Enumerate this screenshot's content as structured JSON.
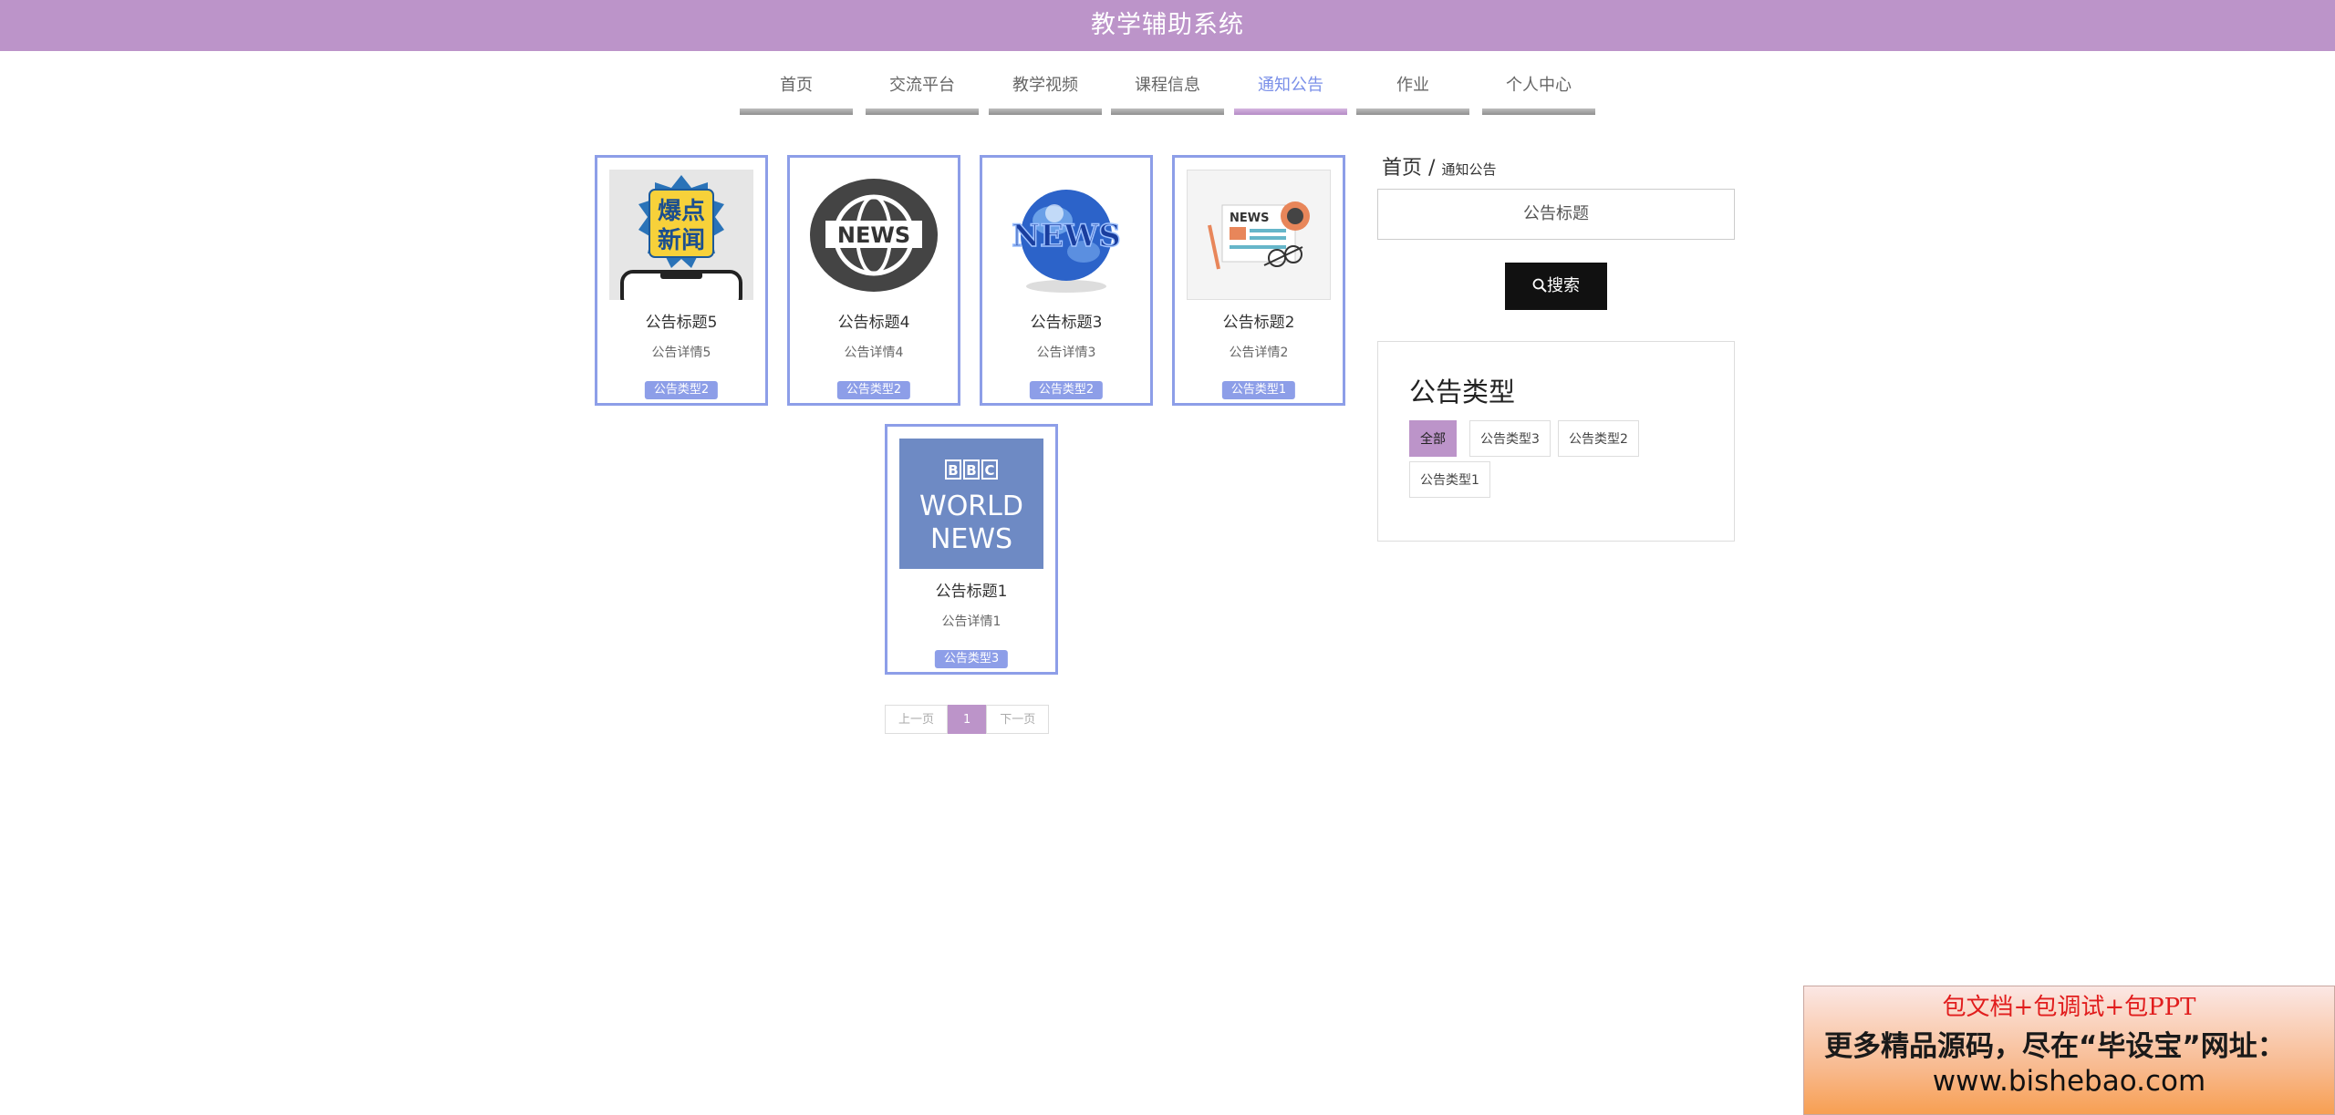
{
  "header": {
    "title": "教学辅助系统",
    "background": "#bc94c9"
  },
  "nav": {
    "items": [
      {
        "label": "首页"
      },
      {
        "label": "交流平台"
      },
      {
        "label": "教学视频"
      },
      {
        "label": "课程信息"
      },
      {
        "label": "通知公告",
        "active": true
      },
      {
        "label": "作业"
      },
      {
        "label": "个人中心"
      }
    ]
  },
  "notices": [
    {
      "title": "公告标题5",
      "desc": "公告详情5",
      "type": "公告类型2",
      "image": {
        "text1": "爆点",
        "text2": "新闻"
      }
    },
    {
      "title": "公告标题4",
      "desc": "公告详情4",
      "type": "公告类型2",
      "image": {
        "text": "NEWS"
      }
    },
    {
      "title": "公告标题3",
      "desc": "公告详情3",
      "type": "公告类型2",
      "image": {
        "text": "NEWS"
      }
    },
    {
      "title": "公告标题2",
      "desc": "公告详情2",
      "type": "公告类型1",
      "image": {
        "text": "NEWS"
      }
    },
    {
      "title": "公告标题1",
      "desc": "公告详情1",
      "type": "公告类型3",
      "image": {
        "bbc": [
          "B",
          "B",
          "C"
        ],
        "line2": "WORLD",
        "line3": "NEWS"
      }
    }
  ],
  "pagination": {
    "prev": "上一页",
    "current": "1",
    "next": "下一页"
  },
  "breadcrumb": {
    "home": "首页",
    "separator": "/",
    "current": "通知公告"
  },
  "search": {
    "placeholder": "公告标题",
    "button": "搜索"
  },
  "types": {
    "title": "公告类型",
    "items": [
      "全部",
      "公告类型3",
      "公告类型2",
      "公告类型1"
    ],
    "active_index": 0
  },
  "ad": {
    "line1": "包文档+包调试+包PPT",
    "line2": "更多精品源码，尽在“毕设宝”网址：",
    "line3": "www.bishebao.com"
  },
  "colors": {
    "accent": "#bc94c9",
    "card_border": "#8d9ee8",
    "active_nav_text": "#7a8fe8"
  }
}
